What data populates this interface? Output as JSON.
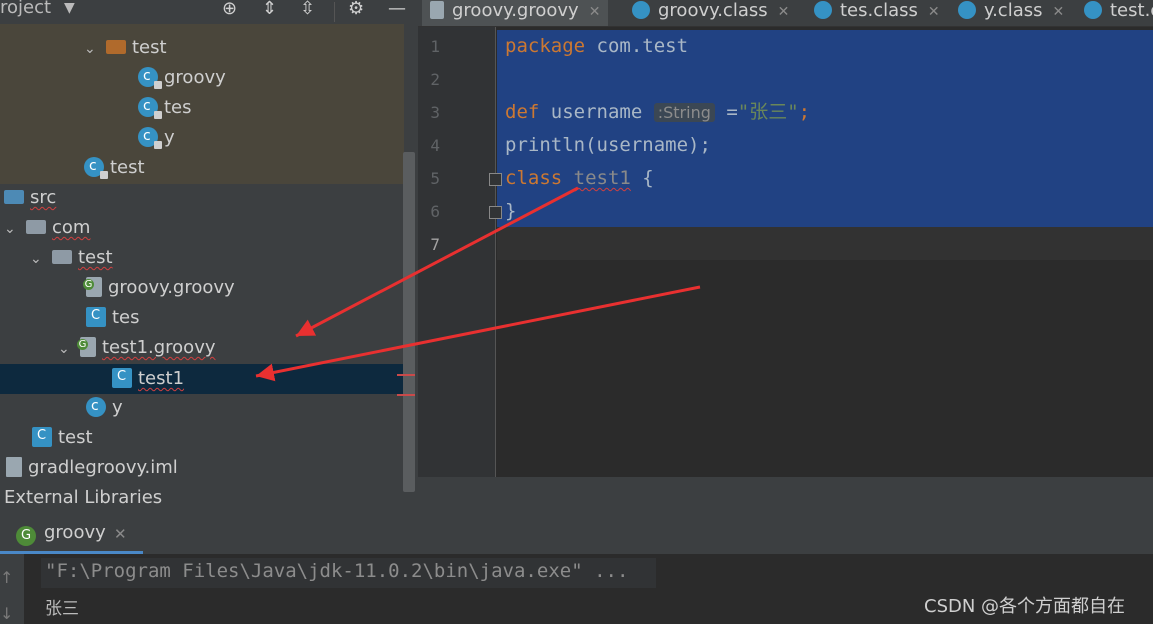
{
  "project_panel": {
    "title": "roject",
    "tree": [
      {
        "label": "test",
        "icon": "folder-icon"
      },
      {
        "label": "groovy",
        "icon": "class-icon"
      },
      {
        "label": "tes",
        "icon": "class-icon"
      },
      {
        "label": "y",
        "icon": "class-icon"
      },
      {
        "label": "test",
        "icon": "class-icon"
      },
      {
        "label": "src",
        "icon": "folder-icon"
      },
      {
        "label": "com",
        "icon": "package-icon"
      },
      {
        "label": "test",
        "icon": "package-icon"
      },
      {
        "label": "groovy.groovy",
        "icon": "groovy-file-icon"
      },
      {
        "label": "tes",
        "icon": "class-file-icon"
      },
      {
        "label": "test1.groovy",
        "icon": "groovy-file-icon"
      },
      {
        "label": "test1",
        "icon": "class-file-icon"
      },
      {
        "label": "y",
        "icon": "class-icon"
      },
      {
        "label": "test",
        "icon": "class-file-icon"
      },
      {
        "label": "gradlegroovy.iml",
        "icon": "iml-file-icon"
      },
      {
        "label": "External Libraries",
        "icon": ""
      }
    ]
  },
  "editor": {
    "tabs": [
      {
        "label": "groovy.groovy",
        "active": true
      },
      {
        "label": "groovy.class",
        "active": false
      },
      {
        "label": "tes.class",
        "active": false
      },
      {
        "label": "y.class",
        "active": false
      },
      {
        "label": "test.c",
        "active": false
      }
    ],
    "line_numbers": [
      "1",
      "2",
      "3",
      "4",
      "5",
      "6",
      "7"
    ],
    "code": {
      "l1_kw": "package",
      "l1_rest": " com.test",
      "l3_kw": "def",
      "l3_name": " username",
      "l3_hint": ":String",
      "l3_eq": " =",
      "l3_str": "\"张三\"",
      "l3_semi": ";",
      "l4": "println(username);",
      "l5_kw": "class",
      "l5_name": "test1",
      "l5_brace": " {",
      "l6": "}"
    }
  },
  "run_panel": {
    "tab_label": "groovy",
    "command": "\"F:\\Program Files\\Java\\jdk-11.0.2\\bin\\java.exe\" ...",
    "output": "张三"
  },
  "watermark": "CSDN @各个方面都自在",
  "colors": {
    "selection": "#214283",
    "keyword": "#cc7832",
    "string": "#6a8759",
    "arrow": "#e83030"
  }
}
